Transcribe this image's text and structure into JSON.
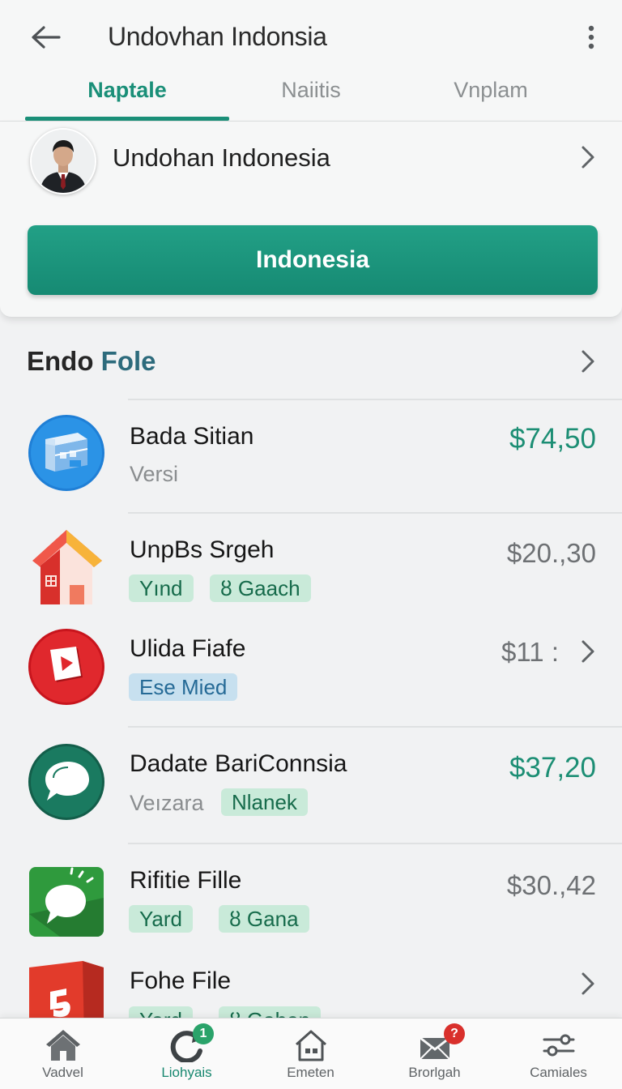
{
  "header": {
    "title": "Undovhan Indonsia",
    "tabs": [
      {
        "label": "Naptale",
        "active": true
      },
      {
        "label": "Naiitis",
        "active": false
      },
      {
        "label": "Vnplam",
        "active": false
      }
    ],
    "accent_color": "#1a8f78"
  },
  "profile": {
    "name": "Undohan Indonesia",
    "button_label": "Indonesia"
  },
  "section": {
    "title_part1": "Endo",
    "title_part2": "Fole"
  },
  "items": [
    {
      "title": "Bada Sitian",
      "subtitle": "Versi",
      "price": "$74,50",
      "icon": "stack-app-icon"
    },
    {
      "title": "UnpBs Srgeh",
      "price": "$20.,30",
      "chips": [
        "Yınd",
        "ȣ Gaach"
      ],
      "icon": "house-app-icon"
    },
    {
      "title": "Ulida Fiafe",
      "price": "$11 :",
      "chips": [
        "Ese Mied"
      ],
      "icon": "video-app-icon"
    },
    {
      "title": "Dadate BariConnsia",
      "subtitle": "Veızara",
      "price": "$37,20",
      "chips": [
        "Nlanek"
      ],
      "icon": "chat-app-icon"
    },
    {
      "title": "Rifitie Fille",
      "price": "$30.,42",
      "chips": [
        "Yard",
        "ȣ Gana"
      ],
      "icon": "message-app-icon"
    },
    {
      "title": "Fohe File",
      "chips": [
        "Yard",
        "ȣ Gahen"
      ],
      "icon": "document-app-icon"
    }
  ],
  "bottom_nav": [
    {
      "label": "Vadvel",
      "icon": "home-icon",
      "active": false
    },
    {
      "label": "Liohyais",
      "icon": "refresh-icon",
      "active": true,
      "badge": "1"
    },
    {
      "label": "Emeten",
      "icon": "house-outline-icon",
      "active": false
    },
    {
      "label": "Brorlgah",
      "icon": "mail-icon",
      "active": false,
      "badge": "?"
    },
    {
      "label": "Camiales",
      "icon": "settings-sliders-icon",
      "active": false
    }
  ]
}
